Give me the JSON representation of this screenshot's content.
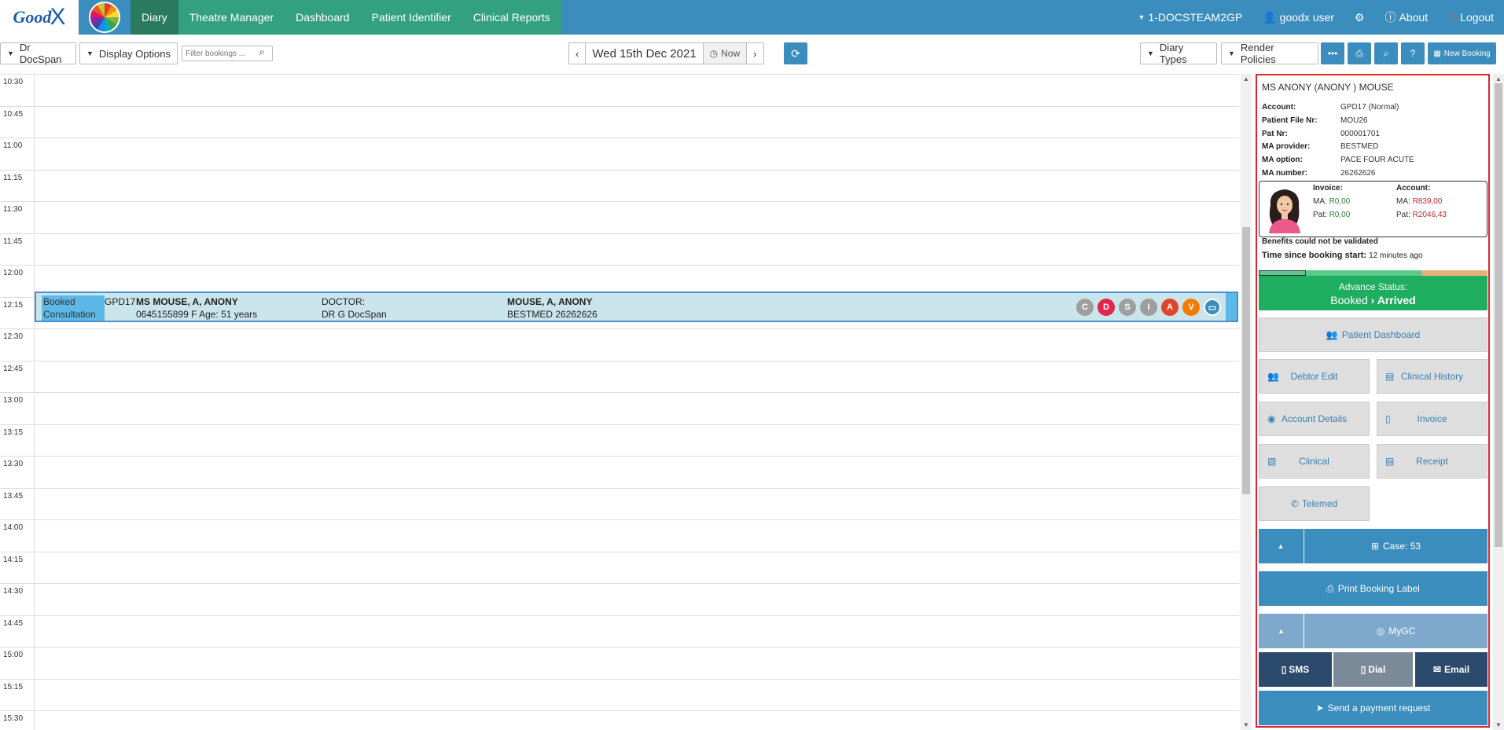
{
  "nav": {
    "logo_text": "Good",
    "logo_x": "X",
    "items": [
      "Diary",
      "Theatre Manager",
      "Dashboard",
      "Patient Identifier",
      "Clinical Reports"
    ],
    "practice": "1-DOCSTEAM2GP",
    "user": "goodx user",
    "about": "About",
    "logout": "Logout"
  },
  "toolbar": {
    "doctor": "Dr DocSpan",
    "display_options": "Display Options",
    "filter_placeholder": "Filter bookings ...",
    "date": "Wed 15th Dec 2021",
    "now": "Now",
    "diary_types": "Diary Types",
    "render_policies": "Render Policies",
    "new_booking": "New Booking"
  },
  "times": [
    "10:30",
    "10:45",
    "11:00",
    "11:15",
    "11:30",
    "11:45",
    "12:00",
    "12:15",
    "12:30",
    "12:45",
    "13:00",
    "13:15",
    "13:30",
    "13:45",
    "14:00",
    "14:15",
    "14:30",
    "14:45",
    "15:00",
    "15:15",
    "15:30"
  ],
  "booking": {
    "status_line1": "Booked",
    "status_line2": "Consultation",
    "code": "GPD17",
    "patient": "MS MOUSE, A, ANONY",
    "details": "0645155899 F Age: 51 years",
    "doctor_label": "DOCTOR:",
    "doctor": "DR G DocSpan",
    "member": "MOUSE, A, ANONY",
    "medical_aid": "BESTMED 26262626",
    "circles": [
      {
        "letter": "C",
        "color": "#9e9e9e"
      },
      {
        "letter": "D",
        "color": "#e0264a"
      },
      {
        "letter": "S",
        "color": "#9e9e9e"
      },
      {
        "letter": "I",
        "color": "#9e9e9e"
      },
      {
        "letter": "A",
        "color": "#e0452a"
      },
      {
        "letter": "V",
        "color": "#f57c00"
      }
    ]
  },
  "panel": {
    "name": "MS ANONY (ANONY ) MOUSE",
    "info": [
      {
        "label": "Account:",
        "value": "GPD17 (Normal)"
      },
      {
        "label": "Patient File Nr:",
        "value": "MOU26"
      },
      {
        "label": "Pat Nr:",
        "value": "000001701"
      },
      {
        "label": "MA provider:",
        "value": "BESTMED"
      },
      {
        "label": "MA option:",
        "value": "PACE FOUR ACUTE"
      },
      {
        "label": "MA number:",
        "value": "26262626"
      }
    ],
    "invoice_label": "Invoice:",
    "invoice_ma_label": "MA:",
    "invoice_ma": "R0,00",
    "invoice_pat_label": "Pat:",
    "invoice_pat": "R0,00",
    "account_label": "Account:",
    "account_ma_label": "MA:",
    "account_ma": "R839,00",
    "account_pat_label": "Pat:",
    "account_pat": "R2046,43",
    "benefits": "Benefits could not be validated",
    "since_label": "Time since booking start:",
    "since_value": "12 minutes ago",
    "progress": 0.71,
    "advance_label": "Advance Status:",
    "advance_from": "Booked",
    "advance_to": "Arrived",
    "patient_dashboard": "Patient Dashboard",
    "debtor_edit": "Debtor Edit",
    "clinical_history": "Clinical History",
    "account_details": "Account Details",
    "invoice": "Invoice",
    "clinical": "Clinical",
    "receipt": "Receipt",
    "telemed": "Telemed",
    "case": "Case: 53",
    "print_label": "Print Booking Label",
    "mygc": "MyGC",
    "sms": "SMS",
    "dial": "Dial",
    "email": "Email",
    "payment_request": "Send a payment request"
  }
}
